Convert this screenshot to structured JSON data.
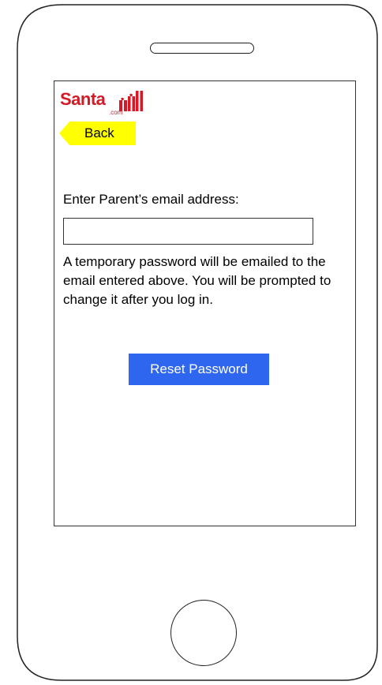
{
  "colors": {
    "logo_red": "#d31a26",
    "back_yellow": "#ffff00",
    "button_blue": "#2f66f0"
  },
  "logo": {
    "brand": "Santa",
    "domain": ".com"
  },
  "nav": {
    "back_label": "Back"
  },
  "form": {
    "email_label": "Enter Parent’s email address:",
    "email_value": "",
    "info_text": "A temporary password will be emailed to the email entered above. You will be prompted to change it after you log in.",
    "reset_label": "Reset Password"
  },
  "icons": {
    "logo_icon": "gift-stack-icon",
    "back_arrow": "back-arrow-icon"
  }
}
